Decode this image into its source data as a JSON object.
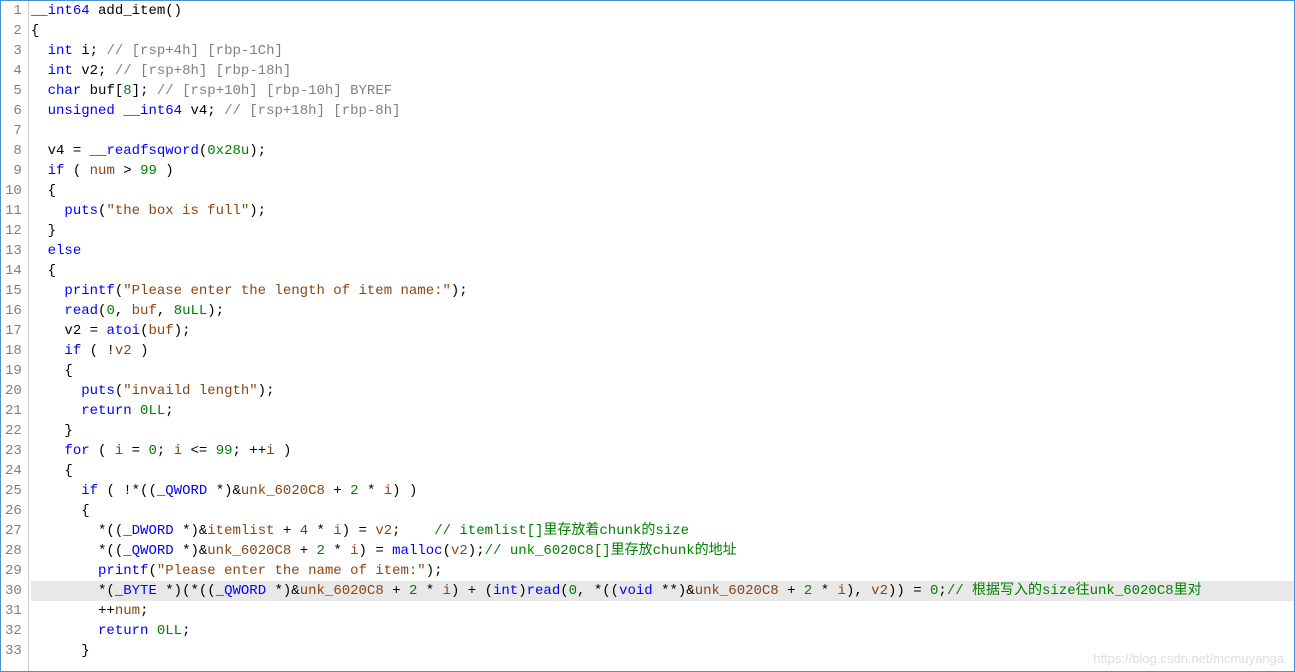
{
  "watermark": "https://blog.csdn.net/mcmuyanga",
  "lines": [
    {
      "n": 1,
      "indent": 0,
      "tokens": [
        {
          "t": "__int64 ",
          "c": "type"
        },
        {
          "t": "add_item",
          "c": "func"
        },
        {
          "t": "()",
          "c": "paren"
        }
      ]
    },
    {
      "n": 2,
      "indent": 0,
      "tokens": [
        {
          "t": "{",
          "c": "paren"
        }
      ]
    },
    {
      "n": 3,
      "indent": 1,
      "tokens": [
        {
          "t": "int ",
          "c": "type"
        },
        {
          "t": "i",
          "c": "var"
        },
        {
          "t": "; ",
          "c": "op"
        },
        {
          "t": "// [rsp+4h] [rbp-1Ch]",
          "c": "comment"
        }
      ]
    },
    {
      "n": 4,
      "indent": 1,
      "tokens": [
        {
          "t": "int ",
          "c": "type"
        },
        {
          "t": "v2",
          "c": "var"
        },
        {
          "t": "; ",
          "c": "op"
        },
        {
          "t": "// [rsp+8h] [rbp-18h]",
          "c": "comment"
        }
      ]
    },
    {
      "n": 5,
      "indent": 1,
      "tokens": [
        {
          "t": "char ",
          "c": "type"
        },
        {
          "t": "buf",
          "c": "var"
        },
        {
          "t": "[",
          "c": "op"
        },
        {
          "t": "8",
          "c": "num-green"
        },
        {
          "t": "]; ",
          "c": "op"
        },
        {
          "t": "// [rsp+10h] [rbp-10h] BYREF",
          "c": "comment"
        }
      ]
    },
    {
      "n": 6,
      "indent": 1,
      "tokens": [
        {
          "t": "unsigned __int64 ",
          "c": "type"
        },
        {
          "t": "v4",
          "c": "var"
        },
        {
          "t": "; ",
          "c": "op"
        },
        {
          "t": "// [rsp+18h] [rbp-8h]",
          "c": "comment"
        }
      ]
    },
    {
      "n": 7,
      "indent": 0,
      "tokens": []
    },
    {
      "n": 8,
      "indent": 1,
      "tokens": [
        {
          "t": "v4 ",
          "c": "var"
        },
        {
          "t": "= ",
          "c": "op"
        },
        {
          "t": "__readfsqword",
          "c": "ident-blue"
        },
        {
          "t": "(",
          "c": "paren"
        },
        {
          "t": "0x28u",
          "c": "num-green"
        },
        {
          "t": ");",
          "c": "paren"
        }
      ]
    },
    {
      "n": 9,
      "indent": 1,
      "tokens": [
        {
          "t": "if ",
          "c": "kw"
        },
        {
          "t": "( ",
          "c": "paren"
        },
        {
          "t": "num ",
          "c": "brown"
        },
        {
          "t": "> ",
          "c": "op"
        },
        {
          "t": "99 ",
          "c": "num-green"
        },
        {
          "t": ")",
          "c": "paren"
        }
      ]
    },
    {
      "n": 10,
      "indent": 1,
      "tokens": [
        {
          "t": "{",
          "c": "paren"
        }
      ]
    },
    {
      "n": 11,
      "indent": 2,
      "tokens": [
        {
          "t": "puts",
          "c": "ident-blue"
        },
        {
          "t": "(",
          "c": "paren"
        },
        {
          "t": "\"the box is full\"",
          "c": "brown"
        },
        {
          "t": ");",
          "c": "paren"
        }
      ]
    },
    {
      "n": 12,
      "indent": 1,
      "tokens": [
        {
          "t": "}",
          "c": "paren"
        }
      ]
    },
    {
      "n": 13,
      "indent": 1,
      "tokens": [
        {
          "t": "else",
          "c": "kw"
        }
      ]
    },
    {
      "n": 14,
      "indent": 1,
      "tokens": [
        {
          "t": "{",
          "c": "paren"
        }
      ]
    },
    {
      "n": 15,
      "indent": 2,
      "tokens": [
        {
          "t": "printf",
          "c": "ident-blue"
        },
        {
          "t": "(",
          "c": "paren"
        },
        {
          "t": "\"Please enter the length of item name:\"",
          "c": "brown"
        },
        {
          "t": ");",
          "c": "paren"
        }
      ]
    },
    {
      "n": 16,
      "indent": 2,
      "tokens": [
        {
          "t": "read",
          "c": "ident-blue"
        },
        {
          "t": "(",
          "c": "paren"
        },
        {
          "t": "0",
          "c": "num-green"
        },
        {
          "t": ", ",
          "c": "op"
        },
        {
          "t": "buf",
          "c": "brown"
        },
        {
          "t": ", ",
          "c": "op"
        },
        {
          "t": "8uLL",
          "c": "num-green"
        },
        {
          "t": ");",
          "c": "paren"
        }
      ]
    },
    {
      "n": 17,
      "indent": 2,
      "tokens": [
        {
          "t": "v2 ",
          "c": "var"
        },
        {
          "t": "= ",
          "c": "op"
        },
        {
          "t": "atoi",
          "c": "ident-blue"
        },
        {
          "t": "(",
          "c": "paren"
        },
        {
          "t": "buf",
          "c": "brown"
        },
        {
          "t": ");",
          "c": "paren"
        }
      ]
    },
    {
      "n": 18,
      "indent": 2,
      "tokens": [
        {
          "t": "if ",
          "c": "kw"
        },
        {
          "t": "( !",
          "c": "paren"
        },
        {
          "t": "v2 ",
          "c": "brown"
        },
        {
          "t": ")",
          "c": "paren"
        }
      ]
    },
    {
      "n": 19,
      "indent": 2,
      "tokens": [
        {
          "t": "{",
          "c": "paren"
        }
      ]
    },
    {
      "n": 20,
      "indent": 3,
      "tokens": [
        {
          "t": "puts",
          "c": "ident-blue"
        },
        {
          "t": "(",
          "c": "paren"
        },
        {
          "t": "\"invaild length\"",
          "c": "brown"
        },
        {
          "t": ");",
          "c": "paren"
        }
      ]
    },
    {
      "n": 21,
      "indent": 3,
      "tokens": [
        {
          "t": "return ",
          "c": "kw"
        },
        {
          "t": "0LL",
          "c": "num-green"
        },
        {
          "t": ";",
          "c": "op"
        }
      ]
    },
    {
      "n": 22,
      "indent": 2,
      "tokens": [
        {
          "t": "}",
          "c": "paren"
        }
      ]
    },
    {
      "n": 23,
      "indent": 2,
      "tokens": [
        {
          "t": "for ",
          "c": "kw"
        },
        {
          "t": "( ",
          "c": "paren"
        },
        {
          "t": "i ",
          "c": "brown"
        },
        {
          "t": "= ",
          "c": "op"
        },
        {
          "t": "0",
          "c": "num-green"
        },
        {
          "t": "; ",
          "c": "op"
        },
        {
          "t": "i ",
          "c": "brown"
        },
        {
          "t": "<= ",
          "c": "op"
        },
        {
          "t": "99",
          "c": "num-green"
        },
        {
          "t": "; ++",
          "c": "op"
        },
        {
          "t": "i ",
          "c": "brown"
        },
        {
          "t": ")",
          "c": "paren"
        }
      ]
    },
    {
      "n": 24,
      "indent": 2,
      "tokens": [
        {
          "t": "{",
          "c": "paren"
        }
      ]
    },
    {
      "n": 25,
      "indent": 3,
      "tokens": [
        {
          "t": "if ",
          "c": "kw"
        },
        {
          "t": "( !*((",
          "c": "paren"
        },
        {
          "t": "_QWORD ",
          "c": "type"
        },
        {
          "t": "*)&",
          "c": "op"
        },
        {
          "t": "unk_6020C8 ",
          "c": "brown"
        },
        {
          "t": "+ ",
          "c": "op"
        },
        {
          "t": "2 ",
          "c": "num-green"
        },
        {
          "t": "* ",
          "c": "op"
        },
        {
          "t": "i",
          "c": "brown"
        },
        {
          "t": ") )",
          "c": "paren"
        }
      ]
    },
    {
      "n": 26,
      "indent": 3,
      "tokens": [
        {
          "t": "{",
          "c": "paren"
        }
      ]
    },
    {
      "n": 27,
      "indent": 4,
      "tokens": [
        {
          "t": "*((",
          "c": "paren"
        },
        {
          "t": "_DWORD ",
          "c": "type"
        },
        {
          "t": "*)&",
          "c": "op"
        },
        {
          "t": "itemlist ",
          "c": "brown"
        },
        {
          "t": "+ ",
          "c": "op"
        },
        {
          "t": "4 ",
          "c": "num-green"
        },
        {
          "t": "* ",
          "c": "op"
        },
        {
          "t": "i",
          "c": "brown"
        },
        {
          "t": ") = ",
          "c": "op"
        },
        {
          "t": "v2",
          "c": "brown"
        },
        {
          "t": ";    ",
          "c": "op"
        },
        {
          "t": "// itemlist[]里存放着chunk的size",
          "c": "comment-green"
        }
      ]
    },
    {
      "n": 28,
      "indent": 4,
      "tokens": [
        {
          "t": "*((",
          "c": "paren"
        },
        {
          "t": "_QWORD ",
          "c": "type"
        },
        {
          "t": "*)&",
          "c": "op"
        },
        {
          "t": "unk_6020C8 ",
          "c": "brown"
        },
        {
          "t": "+ ",
          "c": "op"
        },
        {
          "t": "2 ",
          "c": "num-green"
        },
        {
          "t": "* ",
          "c": "op"
        },
        {
          "t": "i",
          "c": "brown"
        },
        {
          "t": ") = ",
          "c": "op"
        },
        {
          "t": "malloc",
          "c": "ident-blue"
        },
        {
          "t": "(",
          "c": "paren"
        },
        {
          "t": "v2",
          "c": "brown"
        },
        {
          "t": ");",
          "c": "paren"
        },
        {
          "t": "// unk_6020C8[]里存放chunk的地址",
          "c": "comment-green"
        }
      ]
    },
    {
      "n": 29,
      "indent": 4,
      "tokens": [
        {
          "t": "printf",
          "c": "ident-blue"
        },
        {
          "t": "(",
          "c": "paren"
        },
        {
          "t": "\"Please enter the name of item:\"",
          "c": "brown"
        },
        {
          "t": ");",
          "c": "paren"
        }
      ]
    },
    {
      "n": 30,
      "indent": 4,
      "highlighted": true,
      "tokens": [
        {
          "t": "*(",
          "c": "paren"
        },
        {
          "t": "_BYTE ",
          "c": "type"
        },
        {
          "t": "*)(*((",
          "c": "paren"
        },
        {
          "t": "_QWORD ",
          "c": "type"
        },
        {
          "t": "*)&",
          "c": "op"
        },
        {
          "t": "unk_6020C8 ",
          "c": "brown"
        },
        {
          "t": "+ ",
          "c": "op"
        },
        {
          "t": "2 ",
          "c": "num-green"
        },
        {
          "t": "* ",
          "c": "op"
        },
        {
          "t": "i",
          "c": "brown"
        },
        {
          "t": ") + (",
          "c": "paren"
        },
        {
          "t": "int",
          "c": "type"
        },
        {
          "t": ")",
          "c": "paren"
        },
        {
          "t": "read",
          "c": "ident-blue"
        },
        {
          "t": "(",
          "c": "paren"
        },
        {
          "t": "0",
          "c": "num-green"
        },
        {
          "t": ", *((",
          "c": "op"
        },
        {
          "t": "void ",
          "c": "type"
        },
        {
          "t": "**)&",
          "c": "op"
        },
        {
          "t": "unk_6020C8 ",
          "c": "brown"
        },
        {
          "t": "+ ",
          "c": "op"
        },
        {
          "t": "2 ",
          "c": "num-green"
        },
        {
          "t": "* ",
          "c": "op"
        },
        {
          "t": "i",
          "c": "brown"
        },
        {
          "t": "), ",
          "c": "op"
        },
        {
          "t": "v2",
          "c": "brown"
        },
        {
          "t": ")) = ",
          "c": "op"
        },
        {
          "t": "0",
          "c": "num-green"
        },
        {
          "t": ";",
          "c": "op"
        },
        {
          "t": "// 根据写入的size往unk_6020C8里对",
          "c": "comment-green"
        }
      ]
    },
    {
      "n": 31,
      "indent": 4,
      "tokens": [
        {
          "t": "++",
          "c": "op"
        },
        {
          "t": "num",
          "c": "brown"
        },
        {
          "t": ";",
          "c": "op"
        }
      ]
    },
    {
      "n": 32,
      "indent": 4,
      "tokens": [
        {
          "t": "return ",
          "c": "kw"
        },
        {
          "t": "0LL",
          "c": "num-green"
        },
        {
          "t": ";",
          "c": "op"
        }
      ]
    },
    {
      "n": 33,
      "indent": 3,
      "tokens": [
        {
          "t": "}",
          "c": "paren"
        }
      ]
    }
  ]
}
